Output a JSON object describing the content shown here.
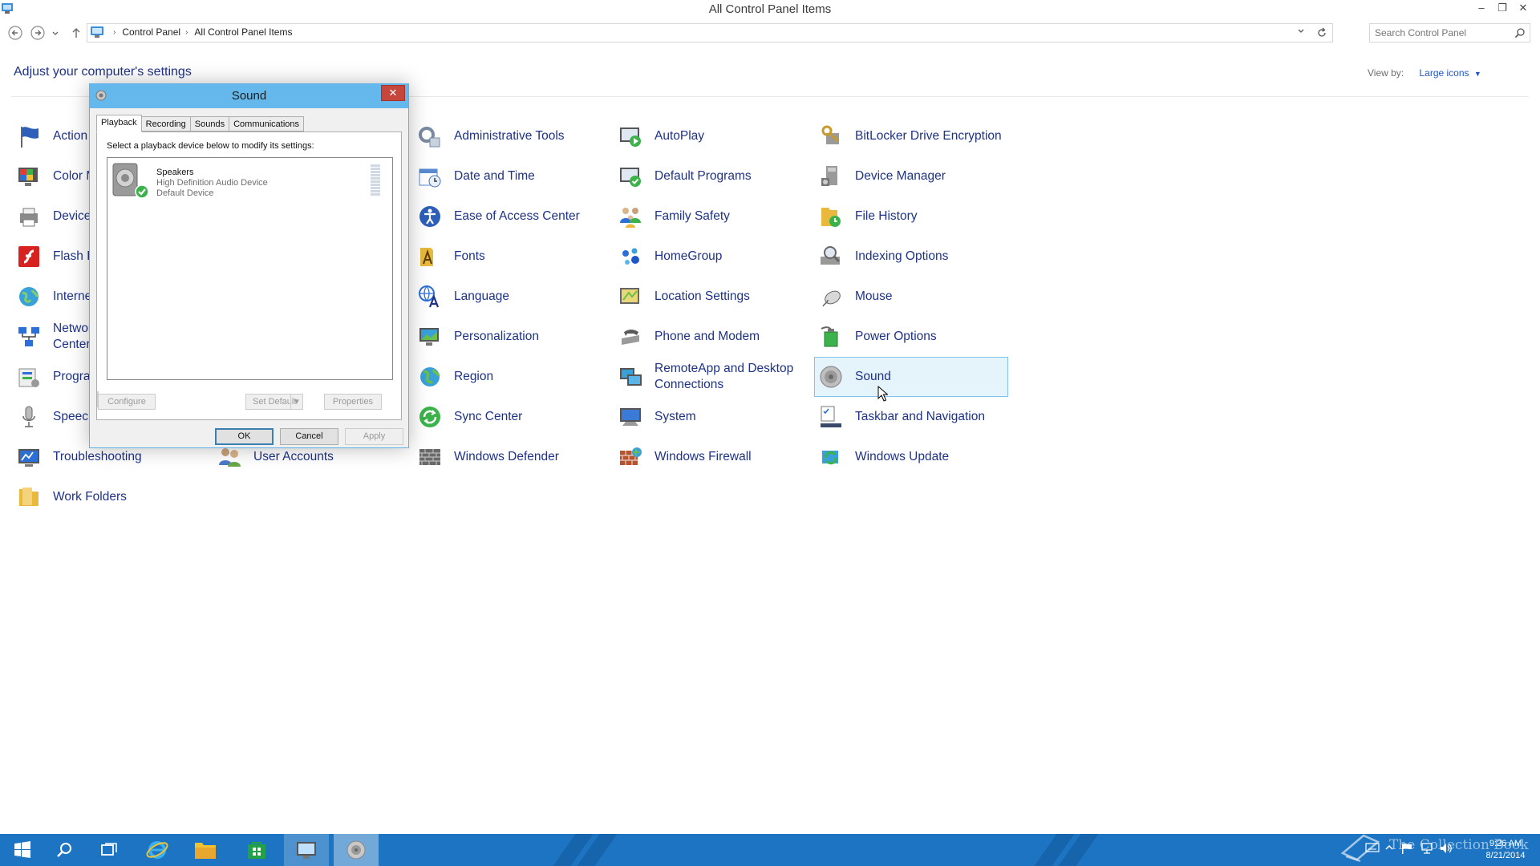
{
  "window": {
    "title": "All Control Panel Items",
    "minimize": "–",
    "maximize": "❐",
    "close": "✕"
  },
  "address": {
    "crumbs": [
      "Control Panel",
      "All Control Panel Items"
    ],
    "separator": "›",
    "search_placeholder": "Search Control Panel"
  },
  "header": {
    "title": "Adjust your computer's settings",
    "view_by_label": "View by:",
    "view_by_value": "Large icons"
  },
  "items": {
    "action_center": "Action",
    "color_management": "Color M",
    "devices_printers": "Devices",
    "flash_player": "Flash P",
    "internet_options": "Interne",
    "network_sharing_1": "Networ",
    "network_sharing_2": "Center",
    "programs_features": "Progra",
    "speech_recognition": "Speech",
    "troubleshooting": "Troubleshooting",
    "work_folders": "Work Folders",
    "user_accounts": "User Accounts",
    "administrative_tools": "Administrative Tools",
    "date_time": "Date and Time",
    "ease_of_access": "Ease of Access Center",
    "fonts": "Fonts",
    "language": "Language",
    "personalization": "Personalization",
    "region": "Region",
    "sync_center": "Sync Center",
    "windows_defender": "Windows Defender",
    "autoplay": "AutoPlay",
    "default_programs": "Default Programs",
    "family_safety": "Family Safety",
    "homegroup": "HomeGroup",
    "location_settings": "Location Settings",
    "phone_modem": "Phone and Modem",
    "remoteapp_1": "RemoteApp and Desktop",
    "remoteapp_2": "Connections",
    "system": "System",
    "windows_firewall": "Windows Firewall",
    "bitlocker": "BitLocker Drive Encryption",
    "device_manager": "Device Manager",
    "file_history": "File History",
    "indexing_options": "Indexing Options",
    "mouse": "Mouse",
    "power_options": "Power Options",
    "sound": "Sound",
    "taskbar_navigation": "Taskbar and Navigation",
    "windows_update": "Windows Update"
  },
  "dialog": {
    "title": "Sound",
    "close": "✕",
    "tabs": [
      "Playback",
      "Recording",
      "Sounds",
      "Communications"
    ],
    "instruction": "Select a playback device below to modify its settings:",
    "device": {
      "name": "Speakers",
      "driver": "High Definition Audio Device",
      "status": "Default Device"
    },
    "buttons": {
      "configure": "Configure",
      "set_default": "Set Default",
      "properties": "Properties",
      "ok": "OK",
      "cancel": "Cancel",
      "apply": "Apply"
    }
  },
  "taskbar": {
    "time": "9:26 AM",
    "date": "8/21/2014"
  },
  "watermark": "The Collection Book",
  "colors": {
    "link_blue": "#1e3287",
    "accent_blue": "#1e55c8",
    "taskbar": "#1c74c2",
    "dialog_title": "#65b8ec",
    "selection": "#e5f3fb"
  }
}
